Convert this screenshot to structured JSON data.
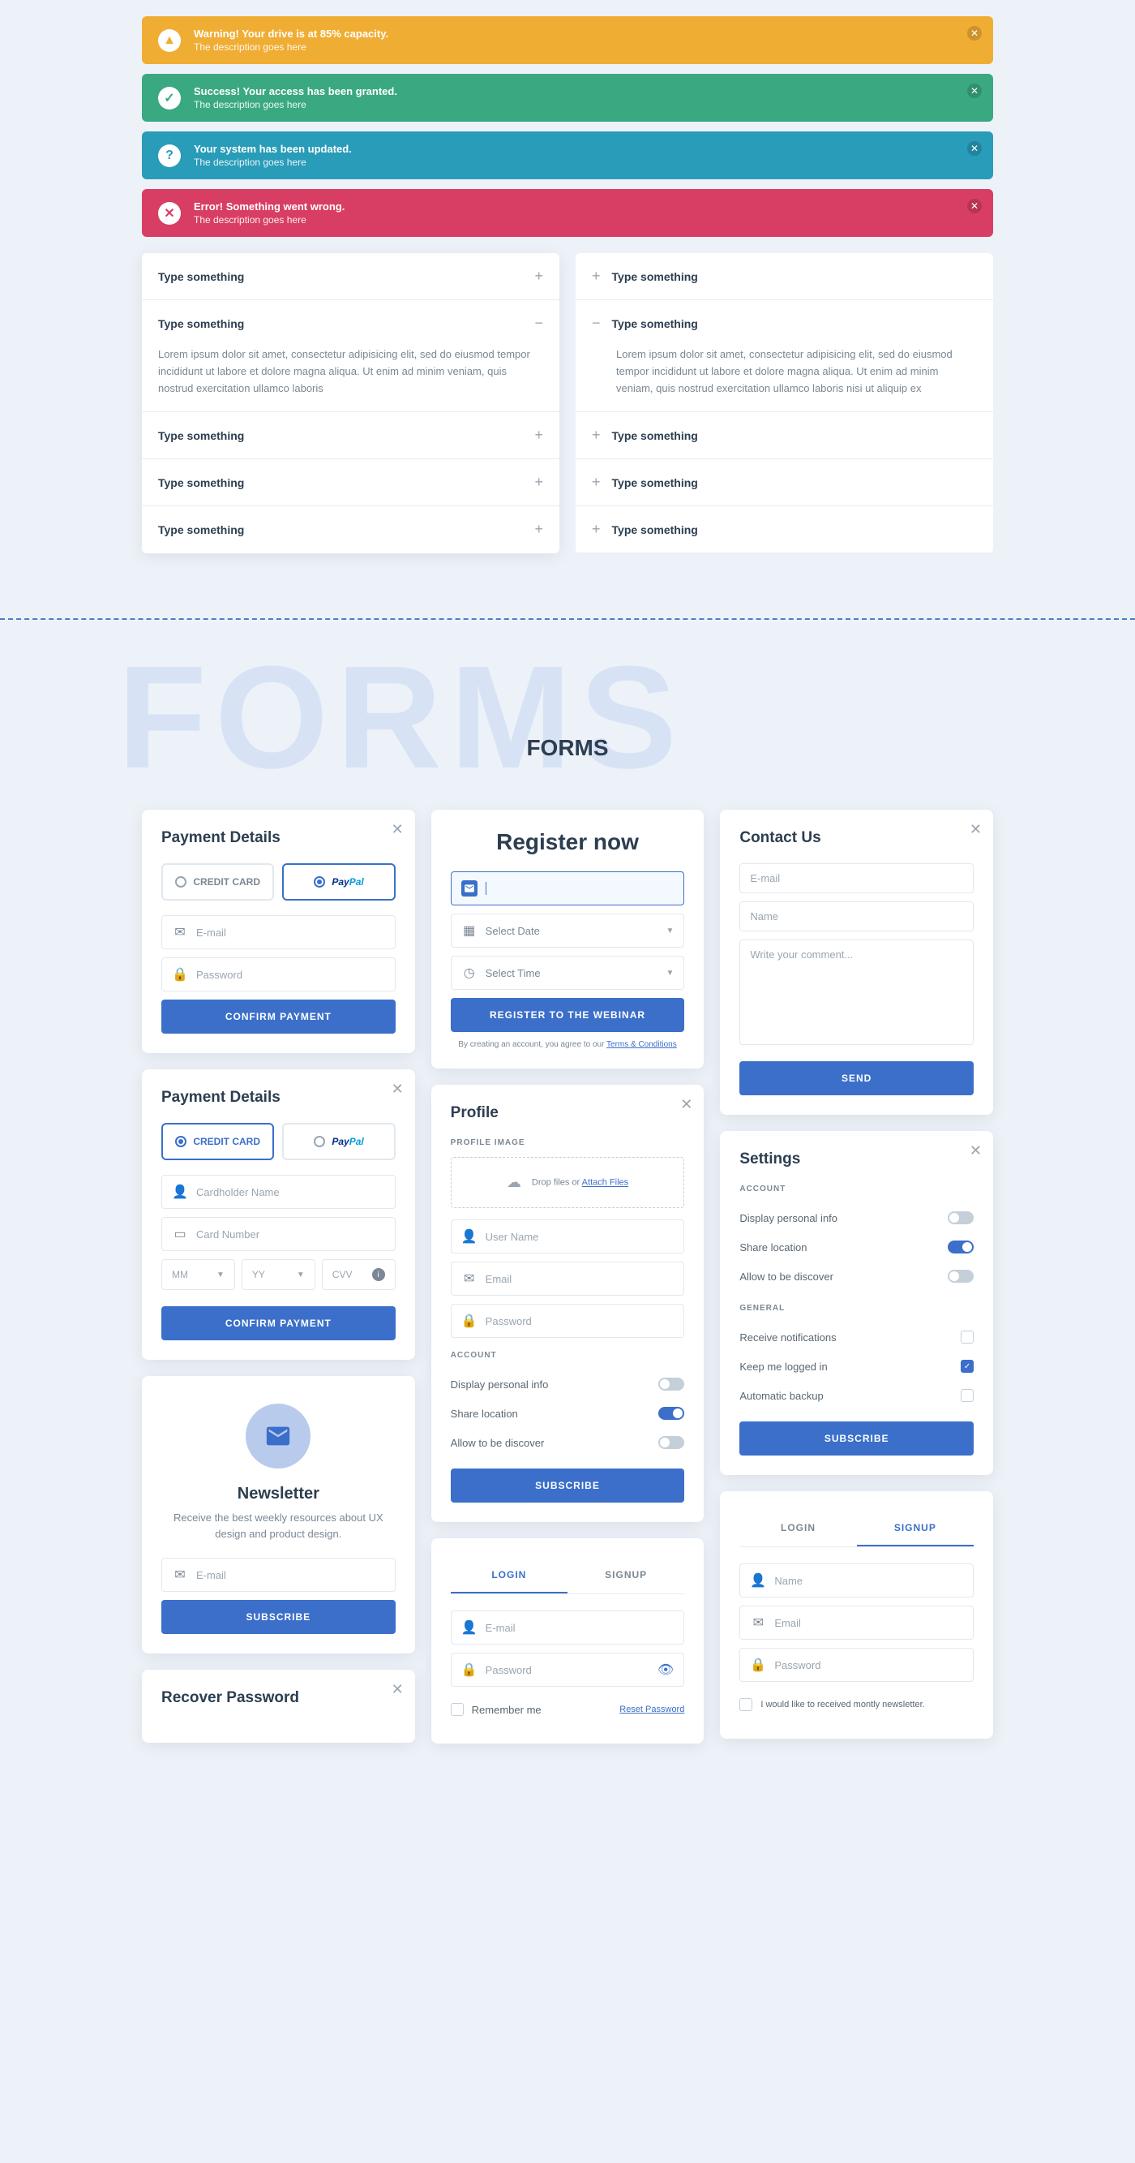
{
  "alerts": [
    {
      "type": "warning",
      "icon": "▲",
      "title": "Warning! Your drive is at 85% capacity.",
      "desc": "The description goes here"
    },
    {
      "type": "success",
      "icon": "✓",
      "title": "Success! Your access has been granted.",
      "desc": "The description goes here"
    },
    {
      "type": "info",
      "icon": "?",
      "title": "Your system has been updated.",
      "desc": "The description goes here"
    },
    {
      "type": "error",
      "icon": "✕",
      "title": "Error! Something went wrong.",
      "desc": "The description goes here"
    }
  ],
  "accordion": {
    "item_title": "Type something",
    "body": "Lorem ipsum dolor sit amet, consectetur adipisicing elit, sed do eiusmod tempor incididunt ut labore et dolore magna aliqua. Ut enim ad minim veniam, quis nostrud exercitation ullamco laboris",
    "body_right": "Lorem ipsum dolor sit amet, consectetur adipisicing elit, sed do eiusmod tempor incididunt ut labore et dolore magna aliqua. Ut enim ad minim veniam, quis nostrud exercitation ullamco laboris nisi ut aliquip ex"
  },
  "section": {
    "bg": "FORMS",
    "title": "FORMS"
  },
  "payment1": {
    "title": "Payment Details",
    "cc": "CREDIT CARD",
    "paypal_pay": "Pay",
    "paypal_pal": "Pal",
    "email_ph": "E-mail",
    "password_ph": "Password",
    "btn": "Confirm Payment"
  },
  "payment2": {
    "title": "Payment Details",
    "cc": "CREDIT CARD",
    "cardholder_ph": "Cardholder Name",
    "cardnum_ph": "Card Number",
    "mm": "MM",
    "yy": "YY",
    "cvv": "CVV",
    "btn": "Confirm Payment"
  },
  "newsletter": {
    "title": "Newsletter",
    "desc": "Receive the best weekly resources about UX design and product design.",
    "email_ph": "E-mail",
    "btn": "Subscribe"
  },
  "recover": {
    "title": "Recover Password"
  },
  "register": {
    "title": "Register now",
    "date_ph": "Select Date",
    "time_ph": "Select Time",
    "btn": "Register to the webinar",
    "terms_pre": "By creating an account, you agree to our ",
    "terms_link": "Terms & Conditions"
  },
  "profile": {
    "title": "Profile",
    "img_label": "PROFILE IMAGE",
    "drop": "Drop files or ",
    "attach": "Attach Files",
    "user_ph": "User Name",
    "email_ph": "Email",
    "password_ph": "Password",
    "account": "ACCOUNT",
    "opt1": "Display personal info",
    "opt2": "Share location",
    "opt3": "Allow to be discover",
    "btn": "Subscribe"
  },
  "login": {
    "tab1": "LOGIN",
    "tab2": "SIGNUP",
    "email_ph": "E-mail",
    "password_ph": "Password",
    "remember": "Remember me",
    "reset": "Reset Password"
  },
  "contact": {
    "title": "Contact Us",
    "email_ph": "E-mail",
    "name_ph": "Name",
    "comment_ph": "Write your comment...",
    "btn": "Send"
  },
  "settings": {
    "title": "Settings",
    "account": "ACCOUNT",
    "opt1": "Display personal info",
    "opt2": "Share location",
    "opt3": "Allow to be discover",
    "general": "GENERAL",
    "opt4": "Receive notifications",
    "opt5": "Keep me logged in",
    "opt6": "Automatic backup",
    "btn": "Subscribe"
  },
  "signup": {
    "tab1": "LOGIN",
    "tab2": "SIGNUP",
    "name_ph": "Name",
    "email_ph": "Email",
    "password_ph": "Password",
    "newsletter": "I would like to received montly newsletter."
  }
}
